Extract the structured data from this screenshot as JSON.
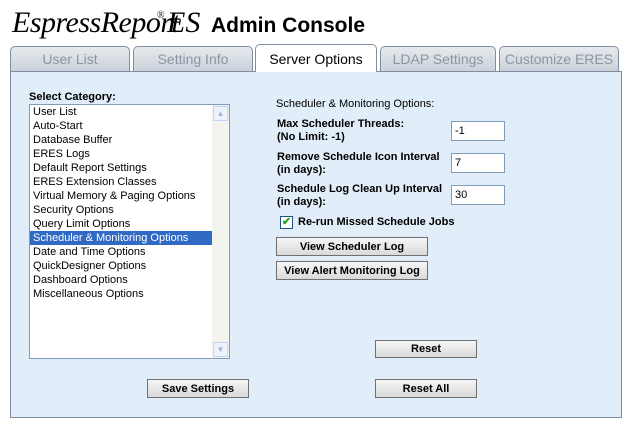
{
  "header": {
    "logo_espresso": "EspressReport",
    "logo_reg": "®",
    "logo_es": "ES",
    "title": "Admin Console"
  },
  "tabs": [
    {
      "label": "User List",
      "active": false
    },
    {
      "label": "Setting Info",
      "active": false
    },
    {
      "label": "Server Options",
      "active": true
    },
    {
      "label": "LDAP Settings",
      "active": false
    },
    {
      "label": "Customize ERES",
      "active": false
    }
  ],
  "category": {
    "label": "Select Category:",
    "items": [
      "User List",
      "Auto-Start",
      "Database Buffer",
      "ERES Logs",
      "Default Report Settings",
      "ERES Extension Classes",
      "Virtual Memory & Paging Options",
      "Security Options",
      "Query Limit Options",
      "Scheduler & Monitoring Options",
      "Date and Time Options",
      "QuickDesigner Options",
      "Dashboard Options",
      "Miscellaneous Options"
    ],
    "selected_index": 9
  },
  "scheduler": {
    "section_title": "Scheduler & Monitoring Options:",
    "max_threads_label_1": "Max Scheduler Threads:",
    "max_threads_label_2": "(No Limit: -1)",
    "max_threads_value": "-1",
    "remove_icon_label_1": "Remove Schedule Icon Interval",
    "remove_icon_label_2": "(in days):",
    "remove_icon_value": "7",
    "log_cleanup_label_1": "Schedule Log Clean Up Interval",
    "log_cleanup_label_2": "(in days):",
    "log_cleanup_value": "30",
    "rerun_label": "Re-run Missed Schedule Jobs",
    "rerun_checked": true,
    "view_log_button": "View Scheduler Log",
    "view_alert_button": "View Alert Monitoring Log"
  },
  "footer": {
    "reset_button": "Reset",
    "save_button": "Save Settings",
    "reset_all_button": "Reset All"
  },
  "icons": {
    "scroll_up": "scroll-up-arrow-icon",
    "scroll_down": "scroll-down-arrow-icon",
    "check": "checkmark-icon"
  }
}
